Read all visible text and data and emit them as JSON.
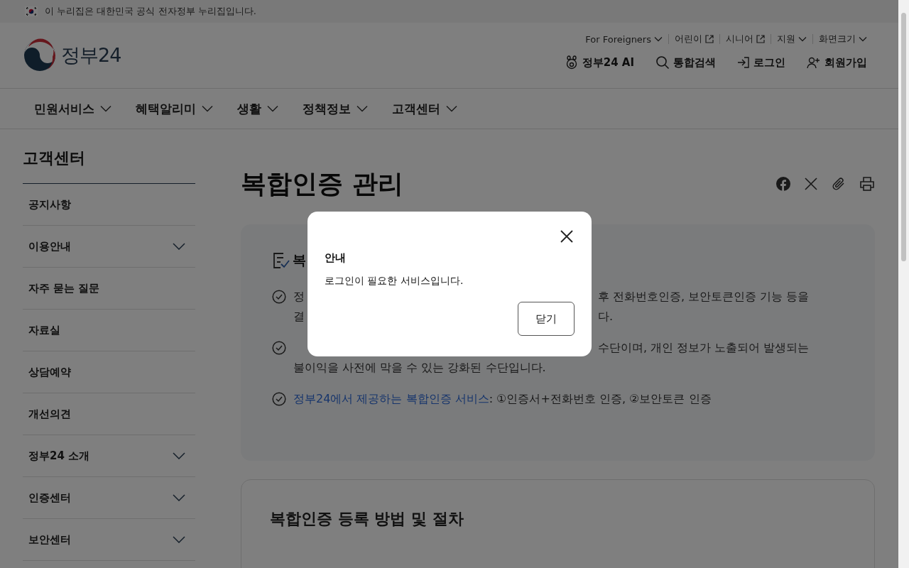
{
  "gov_banner": {
    "text": "이 누리집은 대한민국 공식 전자정부 누리집입니다."
  },
  "header": {
    "logo_text": "정부24",
    "utility_links": [
      {
        "label": "For Foreigners",
        "kind": "dropdown"
      },
      {
        "label": "어린이",
        "kind": "external"
      },
      {
        "label": "시니어",
        "kind": "external"
      },
      {
        "label": "지원",
        "kind": "dropdown"
      },
      {
        "label": "화면크기",
        "kind": "dropdown"
      }
    ],
    "actions": [
      {
        "label": "정부24 AI",
        "kind": "ai"
      },
      {
        "label": "통합검색",
        "kind": "search"
      },
      {
        "label": "로그인",
        "kind": "login"
      },
      {
        "label": "회원가입",
        "kind": "signup"
      }
    ]
  },
  "main_nav": [
    "민원서비스",
    "혜택알리미",
    "생활",
    "정책정보",
    "고객센터"
  ],
  "sidebar": {
    "title": "고객센터",
    "items": [
      {
        "label": "공지사항",
        "expandable": false
      },
      {
        "label": "이용안내",
        "expandable": true
      },
      {
        "label": "자주 묻는 질문",
        "expandable": false
      },
      {
        "label": "자료실",
        "expandable": false
      },
      {
        "label": "상담예약",
        "expandable": false
      },
      {
        "label": "개선의견",
        "expandable": false
      },
      {
        "label": "정부24 소개",
        "expandable": true
      },
      {
        "label": "인증센터",
        "expandable": true
      },
      {
        "label": "보안센터",
        "expandable": true
      }
    ]
  },
  "page": {
    "title": "복합인증 관리",
    "intro": {
      "heading_visible": "복",
      "items": [
        {
          "lines": [
            {
              "left": "정",
              "right": "후 전화번호인증, 보안토큰인증 기능 등을"
            },
            {
              "left": "결",
              "right": "다."
            }
          ]
        },
        {
          "lines": [
            {
              "right": "수단이며, 개인 정보가 노출되어 발생되는"
            },
            {
              "full": "불이익을 사전에 막을 수 있는 강화된 수단입니다."
            }
          ]
        },
        {
          "link": "정부24에서 제공하는 복합인증 서비스",
          "text": " : ①인증서+전화번호 인증, ②보안토큰 인증"
        }
      ]
    },
    "procedure": {
      "title": "복합인증 등록 방법 및 절차"
    }
  },
  "dialog": {
    "title": "안내",
    "message": "로그인이 필요한 서비스입니다.",
    "button": "닫기"
  }
}
